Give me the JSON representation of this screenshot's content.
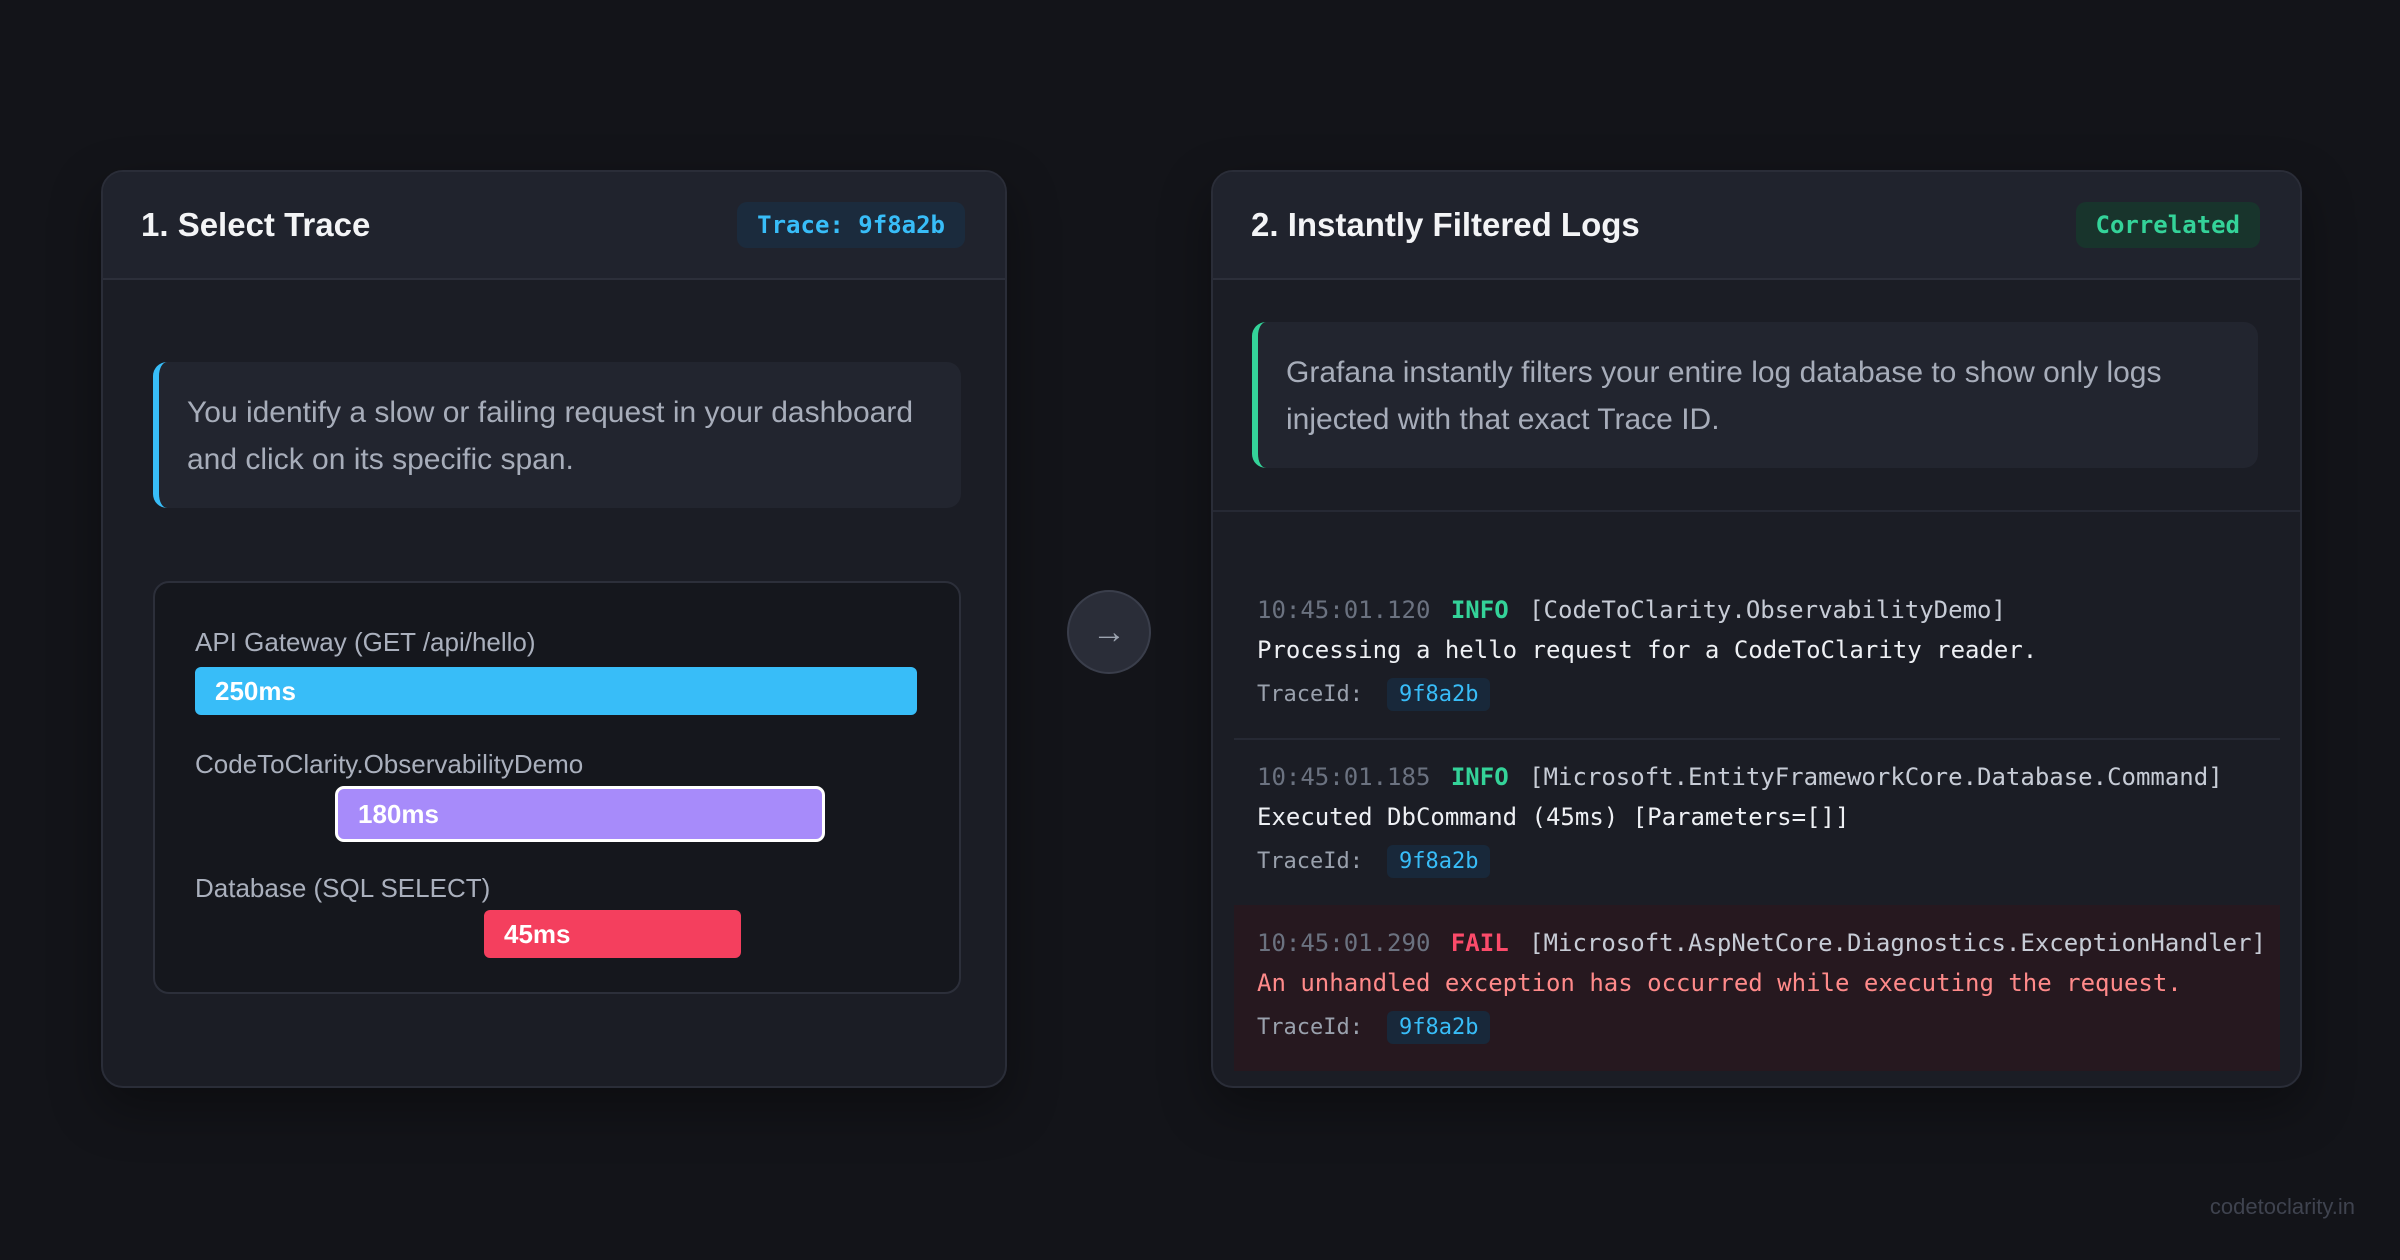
{
  "left_panel": {
    "title": "1. Select Trace",
    "badge": "Trace: 9f8a2b",
    "callout": "You identify a slow or failing request in your dashboard and click on its specific span.",
    "spans": [
      {
        "label": "API Gateway (GET /api/hello)",
        "duration": "250ms",
        "color": "#38bdf8"
      },
      {
        "label": "CodeToClarity.ObservabilityDemo",
        "duration": "180ms",
        "color": "#a78bfa",
        "selected": true
      },
      {
        "label": "Database (SQL SELECT)",
        "duration": "45ms",
        "color": "#f43f5e"
      }
    ]
  },
  "arrow_icon": "→",
  "right_panel": {
    "title": "2. Instantly Filtered Logs",
    "badge": "Correlated",
    "callout": "Grafana instantly filters your entire log database to show only logs injected with that exact Trace ID.",
    "logs": [
      {
        "time": "10:45:01.120",
        "level": "INFO",
        "source": "[CodeToClarity.ObservabilityDemo]",
        "message": "Processing a hello request for a CodeToClarity reader.",
        "trace_label": "TraceId:",
        "trace_id": "9f8a2b"
      },
      {
        "time": "10:45:01.185",
        "level": "INFO",
        "source": "[Microsoft.EntityFrameworkCore.Database.Command]",
        "message": "Executed DbCommand (45ms) [Parameters=[]]",
        "trace_label": "TraceId:",
        "trace_id": "9f8a2b"
      },
      {
        "time": "10:45:01.290",
        "level": "FAIL",
        "source": "[Microsoft.AspNetCore.Diagnostics.ExceptionHandler]",
        "message": "An unhandled exception has occurred while executing the request.",
        "trace_label": "TraceId:",
        "trace_id": "9f8a2b"
      }
    ]
  },
  "footer": "codetoclarity.in",
  "colors": {
    "accent_blue": "#38bdf8",
    "accent_green": "#34d399",
    "fail_red": "#fb4b6a",
    "span_purple": "#a78bfa"
  }
}
